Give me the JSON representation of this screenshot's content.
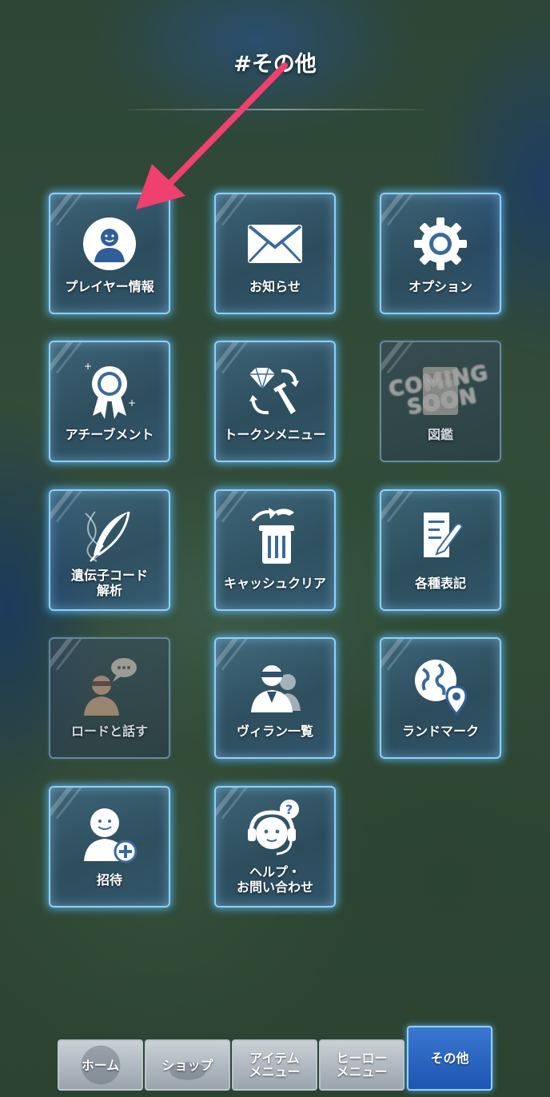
{
  "screen": {
    "title": "#その他"
  },
  "menu_tiles": [
    {
      "label": "プレイヤー情報",
      "icon": "player-avatar-icon"
    },
    {
      "label": "お知らせ",
      "icon": "envelope-icon"
    },
    {
      "label": "オプション",
      "icon": "gear-icon"
    },
    {
      "label": "アチーブメント",
      "icon": "award-ribbon-icon"
    },
    {
      "label": "トークンメニュー",
      "icon": "gem-sword-exchange-icon"
    },
    {
      "label": "図鑑",
      "icon": "book-icon",
      "overlay": "COMING\nSOON",
      "disabled": true
    },
    {
      "label": "遺伝子コード\n解析",
      "icon": "feather-dna-icon"
    },
    {
      "label": "キャッシュクリア",
      "icon": "trash-can-icon"
    },
    {
      "label": "各種表記",
      "icon": "document-pen-icon"
    },
    {
      "label": "ロードと話す",
      "icon": "villain-speech-icon",
      "disabled": true
    },
    {
      "label": "ヴィラン一覧",
      "icon": "villain-group-icon"
    },
    {
      "label": "ランドマーク",
      "icon": "globe-pin-icon"
    },
    {
      "label": "招待",
      "icon": "invite-user-icon"
    },
    {
      "label": "ヘルプ・\nお問い合わせ",
      "icon": "support-headset-icon"
    }
  ],
  "bottom_nav": [
    {
      "label": "ホーム",
      "active": false
    },
    {
      "label": "ショップ",
      "active": false
    },
    {
      "label": "アイテム\nメニュー",
      "active": false
    },
    {
      "label": "ヒーロー\nメニュー",
      "active": false
    },
    {
      "label": "その他",
      "active": true
    }
  ],
  "colors": {
    "arrow": "#f0406e",
    "tile_glow": "#8fd0ff",
    "nav_active": "#2a66c4"
  }
}
